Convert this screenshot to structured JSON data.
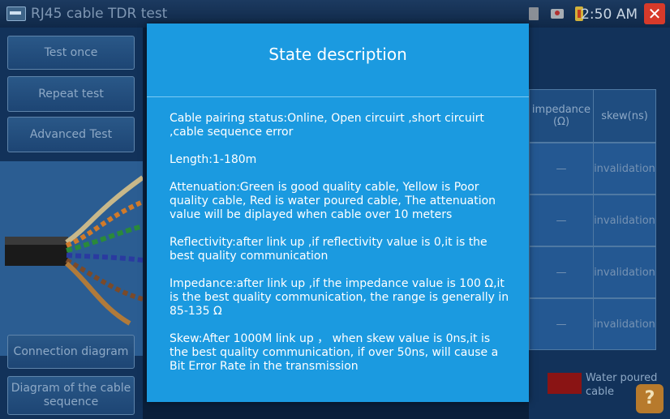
{
  "app": {
    "title": "RJ45 cable TDR test",
    "time": "2:50 AM"
  },
  "left_menu": {
    "test_once": "Test once",
    "repeat_test": "Repeat test",
    "advanced_test": "Advanced Test",
    "connection_diagram": "Connection diagram",
    "diagram_sequence_line1": "Diagram of the cable",
    "diagram_sequence_line2": "sequence"
  },
  "table": {
    "headers": {
      "impedance": "impedance",
      "impedance_unit": "(Ω)",
      "skew": "skew(ns)"
    },
    "rows": [
      {
        "impedance": "—",
        "skew": "invalidation"
      },
      {
        "impedance": "—",
        "skew": "invalidation"
      },
      {
        "impedance": "—",
        "skew": "invalidation"
      },
      {
        "impedance": "—",
        "skew": "invalidation"
      }
    ]
  },
  "legend": {
    "label": "Water poured cable",
    "color": "#8a1414"
  },
  "modal": {
    "title": "State description",
    "paragraphs": [
      "Cable pairing status:Online, Open circuirt ,short circuirt ,cable sequence error",
      "Length:1-180m",
      "Attenuation:Green is good quality cable, Yellow is Poor quality cable, Red is water poured cable, The attenuation value will be diplayed when cable over 10 meters",
      "Reflectivity:after link up ,if reflectivity value is 0,it is the best quality communication",
      "Impedance:after link up ,if the impedance value is 100 Ω,it is the best quality communication, the range is generally in 85-135 Ω",
      "Skew:After 1000M link up ， when skew value is 0ns,it is the best quality communication, if over 50ns, will cause a Bit Error Rate in the transmission"
    ]
  },
  "icons": {
    "app": "cable-tester-icon",
    "sd": "sd-card-icon",
    "wifi": "wifi-off-icon",
    "battery": "battery-charging-icon",
    "close": "close-icon",
    "help": "help-icon"
  },
  "colors": {
    "modal_bg": "#1b9ae0",
    "panel_bg": "#12325a",
    "close_bg": "#d73a2a"
  }
}
